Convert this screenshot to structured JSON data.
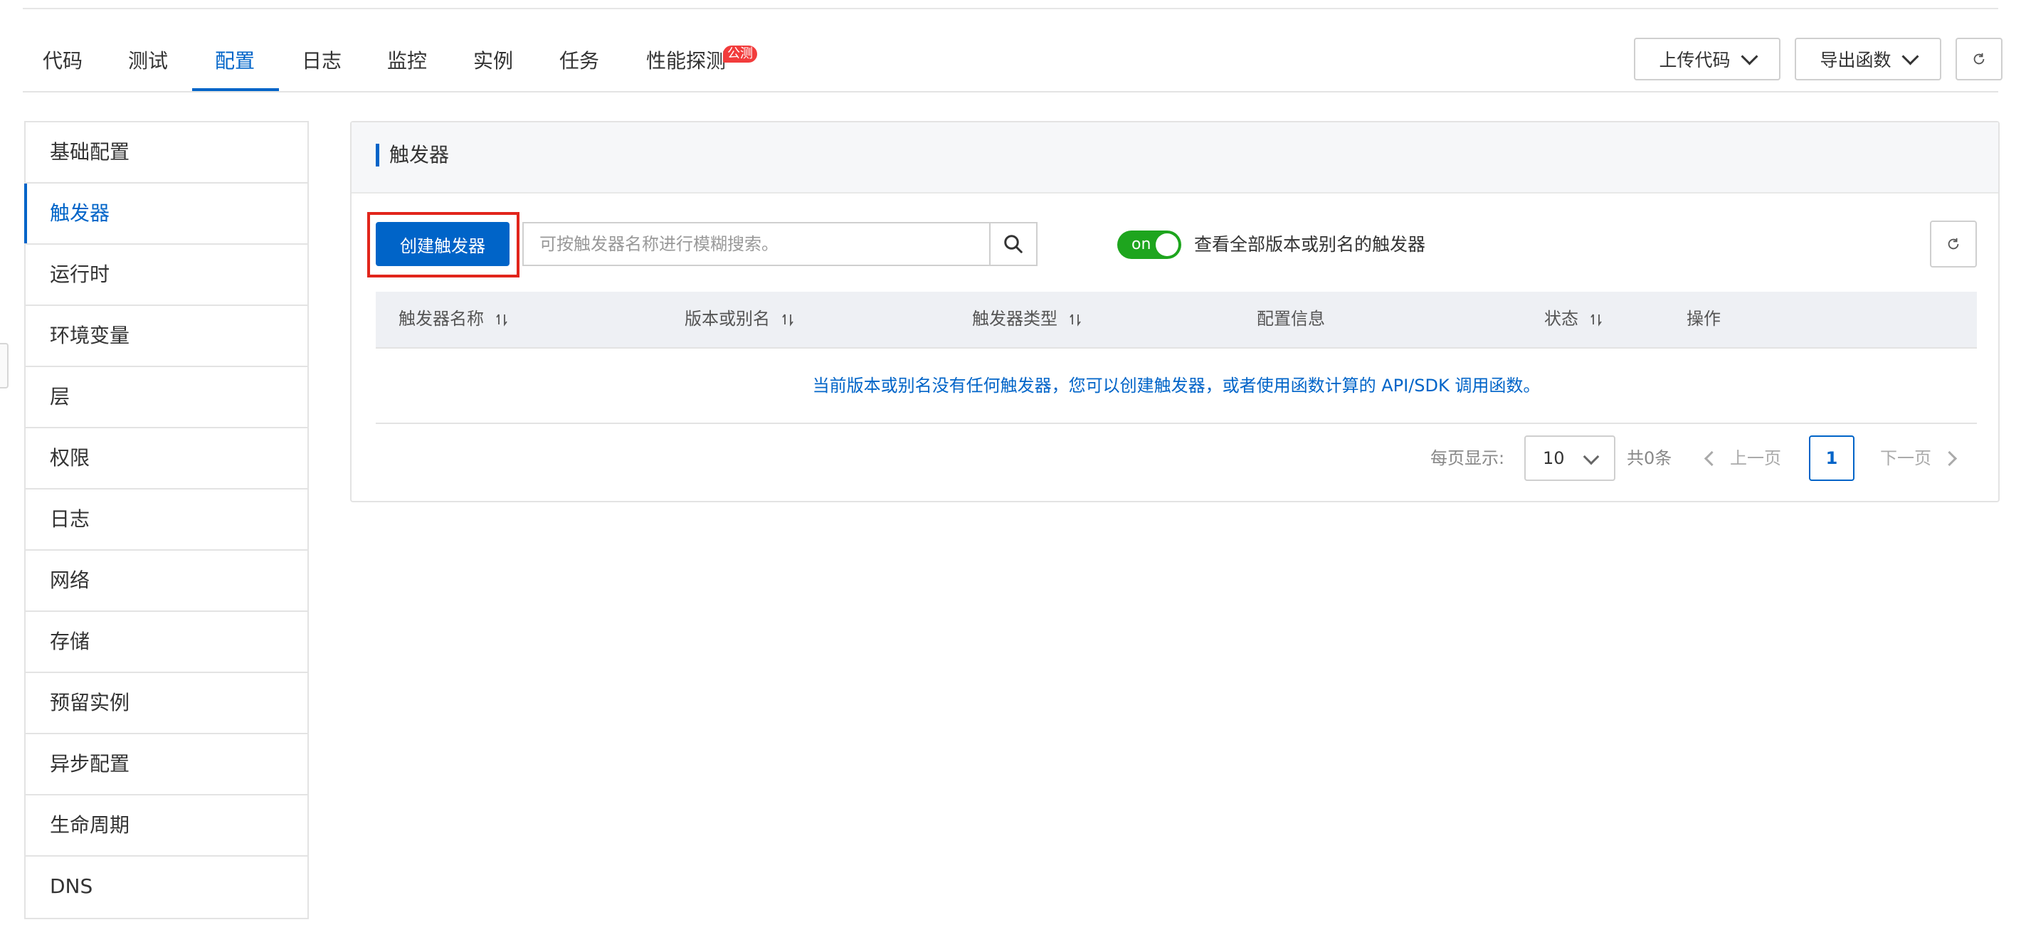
{
  "tabs": [
    {
      "label": "代码"
    },
    {
      "label": "测试"
    },
    {
      "label": "配置"
    },
    {
      "label": "日志"
    },
    {
      "label": "监控"
    },
    {
      "label": "实例"
    },
    {
      "label": "任务"
    },
    {
      "label": "性能探测",
      "badge": "公测"
    }
  ],
  "active_tab": "配置",
  "toolbar": {
    "upload_code": "上传代码",
    "export_function": "导出函数"
  },
  "sidebar": {
    "items": [
      {
        "label": "基础配置"
      },
      {
        "label": "触发器"
      },
      {
        "label": "运行时"
      },
      {
        "label": "环境变量"
      },
      {
        "label": "层"
      },
      {
        "label": "权限"
      },
      {
        "label": "日志"
      },
      {
        "label": "网络"
      },
      {
        "label": "存储"
      },
      {
        "label": "预留实例"
      },
      {
        "label": "异步配置"
      },
      {
        "label": "生命周期"
      },
      {
        "label": "DNS"
      }
    ],
    "active": "触发器"
  },
  "panel": {
    "title": "触发器",
    "create_button": "创建触发器",
    "search_placeholder": "可按触发器名称进行模糊搜索。",
    "switch_text": "on",
    "switch_label": "查看全部版本或别名的触发器"
  },
  "table": {
    "columns": [
      {
        "label": "触发器名称",
        "sortable": true
      },
      {
        "label": "版本或别名",
        "sortable": true
      },
      {
        "label": "触发器类型",
        "sortable": true
      },
      {
        "label": "配置信息",
        "sortable": false
      },
      {
        "label": "状态",
        "sortable": true
      },
      {
        "label": "操作",
        "sortable": false
      }
    ],
    "rows": [],
    "empty_text": "当前版本或别名没有任何触发器，您可以创建触发器，或者使用函数计算的 API/SDK 调用函数。"
  },
  "pagination": {
    "page_size_label": "每页显示:",
    "page_size": "10",
    "total": "共0条",
    "prev": "上一页",
    "current_page": "1",
    "next": "下一页"
  },
  "colors": {
    "accent": "#0064c8",
    "switch_on": "#1ea51e",
    "badge": "#f23c3c",
    "highlight": "#e1251b"
  }
}
